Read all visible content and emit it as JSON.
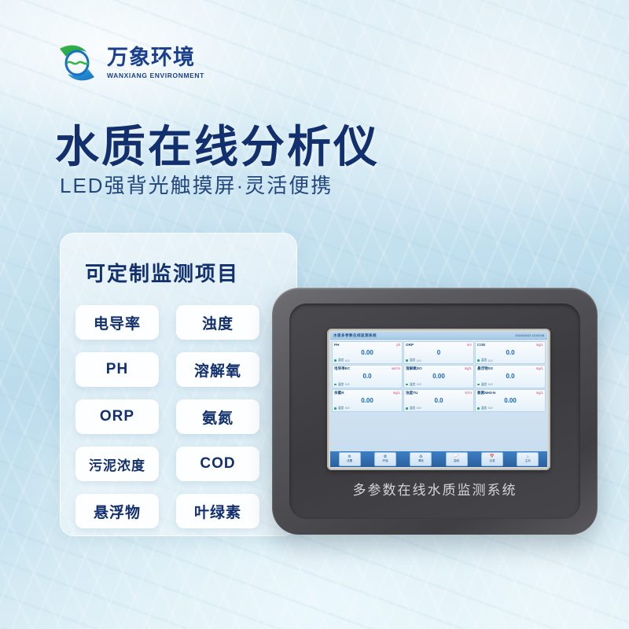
{
  "brand": {
    "name_cn": "万象环境",
    "name_en": "WANXIANG ENVIRONMENT",
    "logo_icon": "wave-swoosh-logo-icon",
    "colors": {
      "blue": "#1b3f8f",
      "green": "#39b54a",
      "cyan": "#29abe2"
    }
  },
  "hero": {
    "title": "水质在线分析仪",
    "subtitle": "LED强背光触摸屏·灵活便携"
  },
  "panel": {
    "title": "可定制监测项目",
    "items": [
      "电导率",
      "浊度",
      "PH",
      "溶解氧",
      "ORP",
      "氨氮",
      "污泥浓度",
      "COD",
      "悬浮物",
      "叶绿素"
    ]
  },
  "device": {
    "caption": "多参数在线水质监测系统",
    "screen": {
      "header_title": "水质多参数在线监测系统",
      "header_time": "2024/08/22 10:53:58",
      "cells": [
        {
          "name": "PH",
          "unit": "ph",
          "value": "0.00",
          "foot_label": "温度",
          "foot_value": "0.0"
        },
        {
          "name": "ORP",
          "unit": "mV",
          "value": "0",
          "foot_label": "温度",
          "foot_value": "0.0"
        },
        {
          "name": "COD",
          "unit": "mg/L",
          "value": "0.0",
          "foot_label": "温度",
          "foot_value": "0.0"
        },
        {
          "name": "电导率EC",
          "unit": "us/cm",
          "value": "0.0",
          "foot_label": "温度",
          "foot_value": "0.0"
        },
        {
          "name": "溶解氧DO",
          "unit": "mg/L",
          "value": "0.00",
          "foot_label": "温度",
          "foot_value": "0.0"
        },
        {
          "name": "悬浮物SS",
          "unit": "mg/L",
          "value": "0.0",
          "foot_label": "温度",
          "foot_value": "0.0"
        },
        {
          "name": "余氯R",
          "unit": "mg/L",
          "value": "0.00",
          "foot_label": "温度",
          "foot_value": "0.0"
        },
        {
          "name": "浊度TU",
          "unit": "NTU",
          "value": "0.0",
          "foot_label": "温度",
          "foot_value": "0.0"
        },
        {
          "name": "氨氮NH3-N",
          "unit": "mg/L",
          "value": "0.00",
          "foot_label": "温度",
          "foot_value": "0.0"
        }
      ],
      "nav": [
        {
          "icon": "gear-icon",
          "label": "设置"
        },
        {
          "icon": "leaf-icon",
          "label": "环保"
        },
        {
          "icon": "trash-icon",
          "label": "清除"
        },
        {
          "icon": "chart-icon",
          "label": "曲线"
        },
        {
          "icon": "calendar-icon",
          "label": "记录"
        },
        {
          "icon": "home-icon",
          "label": "主页"
        }
      ]
    }
  }
}
